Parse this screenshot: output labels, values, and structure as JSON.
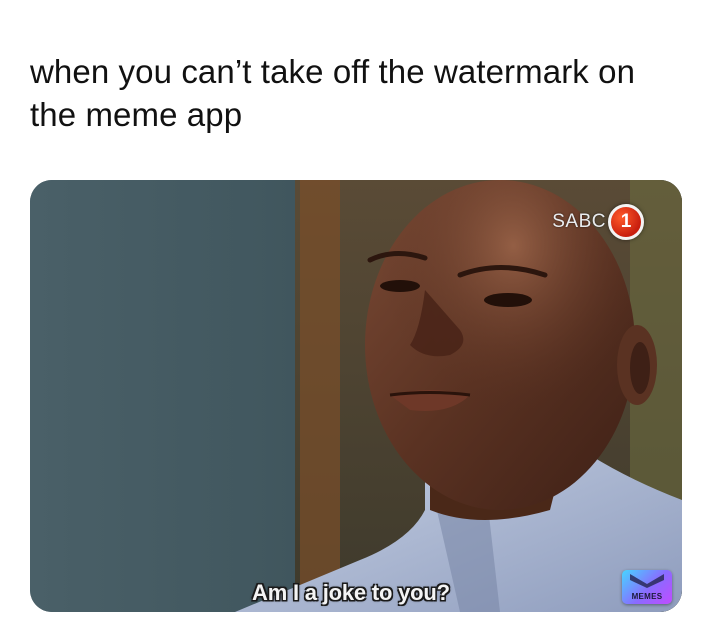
{
  "caption": "when you can’t take off the watermark on the meme app",
  "image": {
    "channel_logo_text": "SABC",
    "channel_logo_number": "1",
    "subtitle": "Am I a joke to you?",
    "watermark_label": "MEMES"
  },
  "colors": {
    "background": "#ffffff",
    "caption_text": "#111111",
    "channel_badge": "#d9261a",
    "watermark_gradient_start": "#46d6ff",
    "watermark_gradient_end": "#c14cff"
  }
}
